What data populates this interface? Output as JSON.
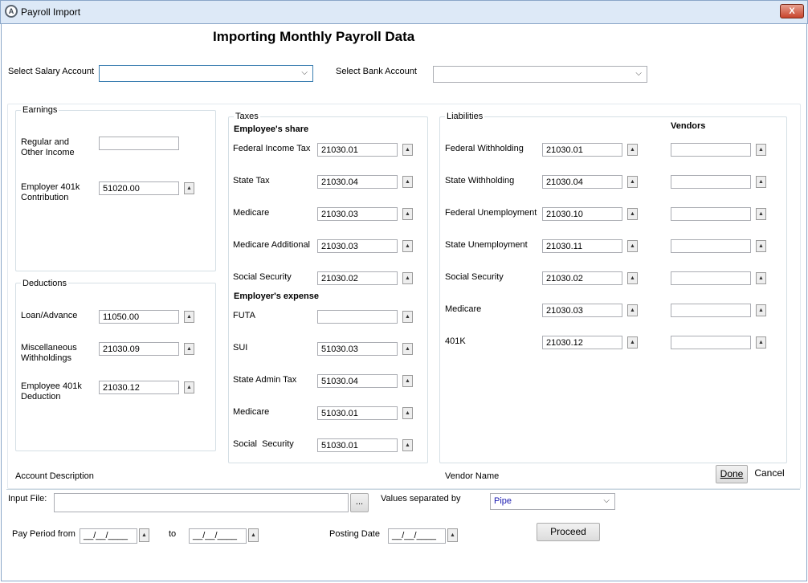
{
  "window": {
    "title": "Payroll Import",
    "app_icon_glyph": "A",
    "close_glyph": "X"
  },
  "page_title": "Importing Monthly Payroll Data",
  "selectors": {
    "salary_label": "Select Salary Account",
    "salary_value": "",
    "bank_label": "Select Bank Account",
    "bank_value": ""
  },
  "earnings": {
    "title": "Earnings",
    "regular_label_1": "Regular and",
    "regular_label_2": "Other Income",
    "regular_value": "",
    "employer401k_label_1": "Employer 401k",
    "employer401k_label_2": "Contribution",
    "employer401k_value": "51020.00"
  },
  "deductions": {
    "title": "Deductions",
    "loan_label": "Loan/Advance",
    "loan_value": "11050.00",
    "misc_label_1": "Miscellaneous",
    "misc_label_2": "Withholdings",
    "misc_value": "21030.09",
    "emp401k_label_1": "Employee 401k",
    "emp401k_label_2": "Deduction",
    "emp401k_value": "21030.12"
  },
  "taxes": {
    "title": "Taxes",
    "employee_share_heading": "Employee's share",
    "employee_rows": [
      {
        "label": "Federal Income Tax",
        "value": "21030.01"
      },
      {
        "label": "State Tax",
        "value": "21030.04"
      },
      {
        "label": "Medicare",
        "value": "21030.03"
      },
      {
        "label": "Medicare Additional",
        "value": "21030.03"
      },
      {
        "label": "Social Security",
        "value": "21030.02"
      }
    ],
    "employer_expense_heading": "Employer's expense",
    "employer_rows": [
      {
        "label": "FUTA",
        "value": ""
      },
      {
        "label": "SUI",
        "value": "51030.03"
      },
      {
        "label": "State Admin Tax",
        "value": "51030.04"
      },
      {
        "label": "Medicare",
        "value": "51030.01"
      },
      {
        "label": "Social  Security",
        "value": "51030.01"
      }
    ]
  },
  "liabilities": {
    "title": "Liabilities",
    "vendors_heading": "Vendors",
    "rows": [
      {
        "label": "Federal Withholding",
        "value": "21030.01",
        "vendor": ""
      },
      {
        "label": "State Withholding",
        "value": "21030.04",
        "vendor": ""
      },
      {
        "label": "Federal Unemployment",
        "value": "21030.10",
        "vendor": ""
      },
      {
        "label": "State Unemployment",
        "value": "21030.11",
        "vendor": ""
      },
      {
        "label": "Social Security",
        "value": "21030.02",
        "vendor": ""
      },
      {
        "label": "Medicare",
        "value": "21030.03",
        "vendor": ""
      },
      {
        "label": "401K",
        "value": "21030.12",
        "vendor": ""
      }
    ]
  },
  "account_description_label": "Account Description",
  "vendor_name_label": "Vendor Name",
  "done_label": "Done",
  "cancel_label": "Cancel",
  "input_file": {
    "label": "Input File:",
    "value": "",
    "browse_label": "..."
  },
  "separator": {
    "label": "Values separated by",
    "value": "Pipe"
  },
  "pay_period": {
    "from_label": "Pay Period from",
    "from_value": "__/__/____",
    "to_label": "to",
    "to_value": "__/__/____"
  },
  "posting_date": {
    "label": "Posting Date",
    "value": "__/__/____"
  },
  "proceed_label": "Proceed",
  "icons": {
    "lookup": "up-arrow-icon",
    "dropdown": "chevron-down-icon"
  },
  "lookup_glyph": "▲",
  "dropdown_glyph": "⌵"
}
